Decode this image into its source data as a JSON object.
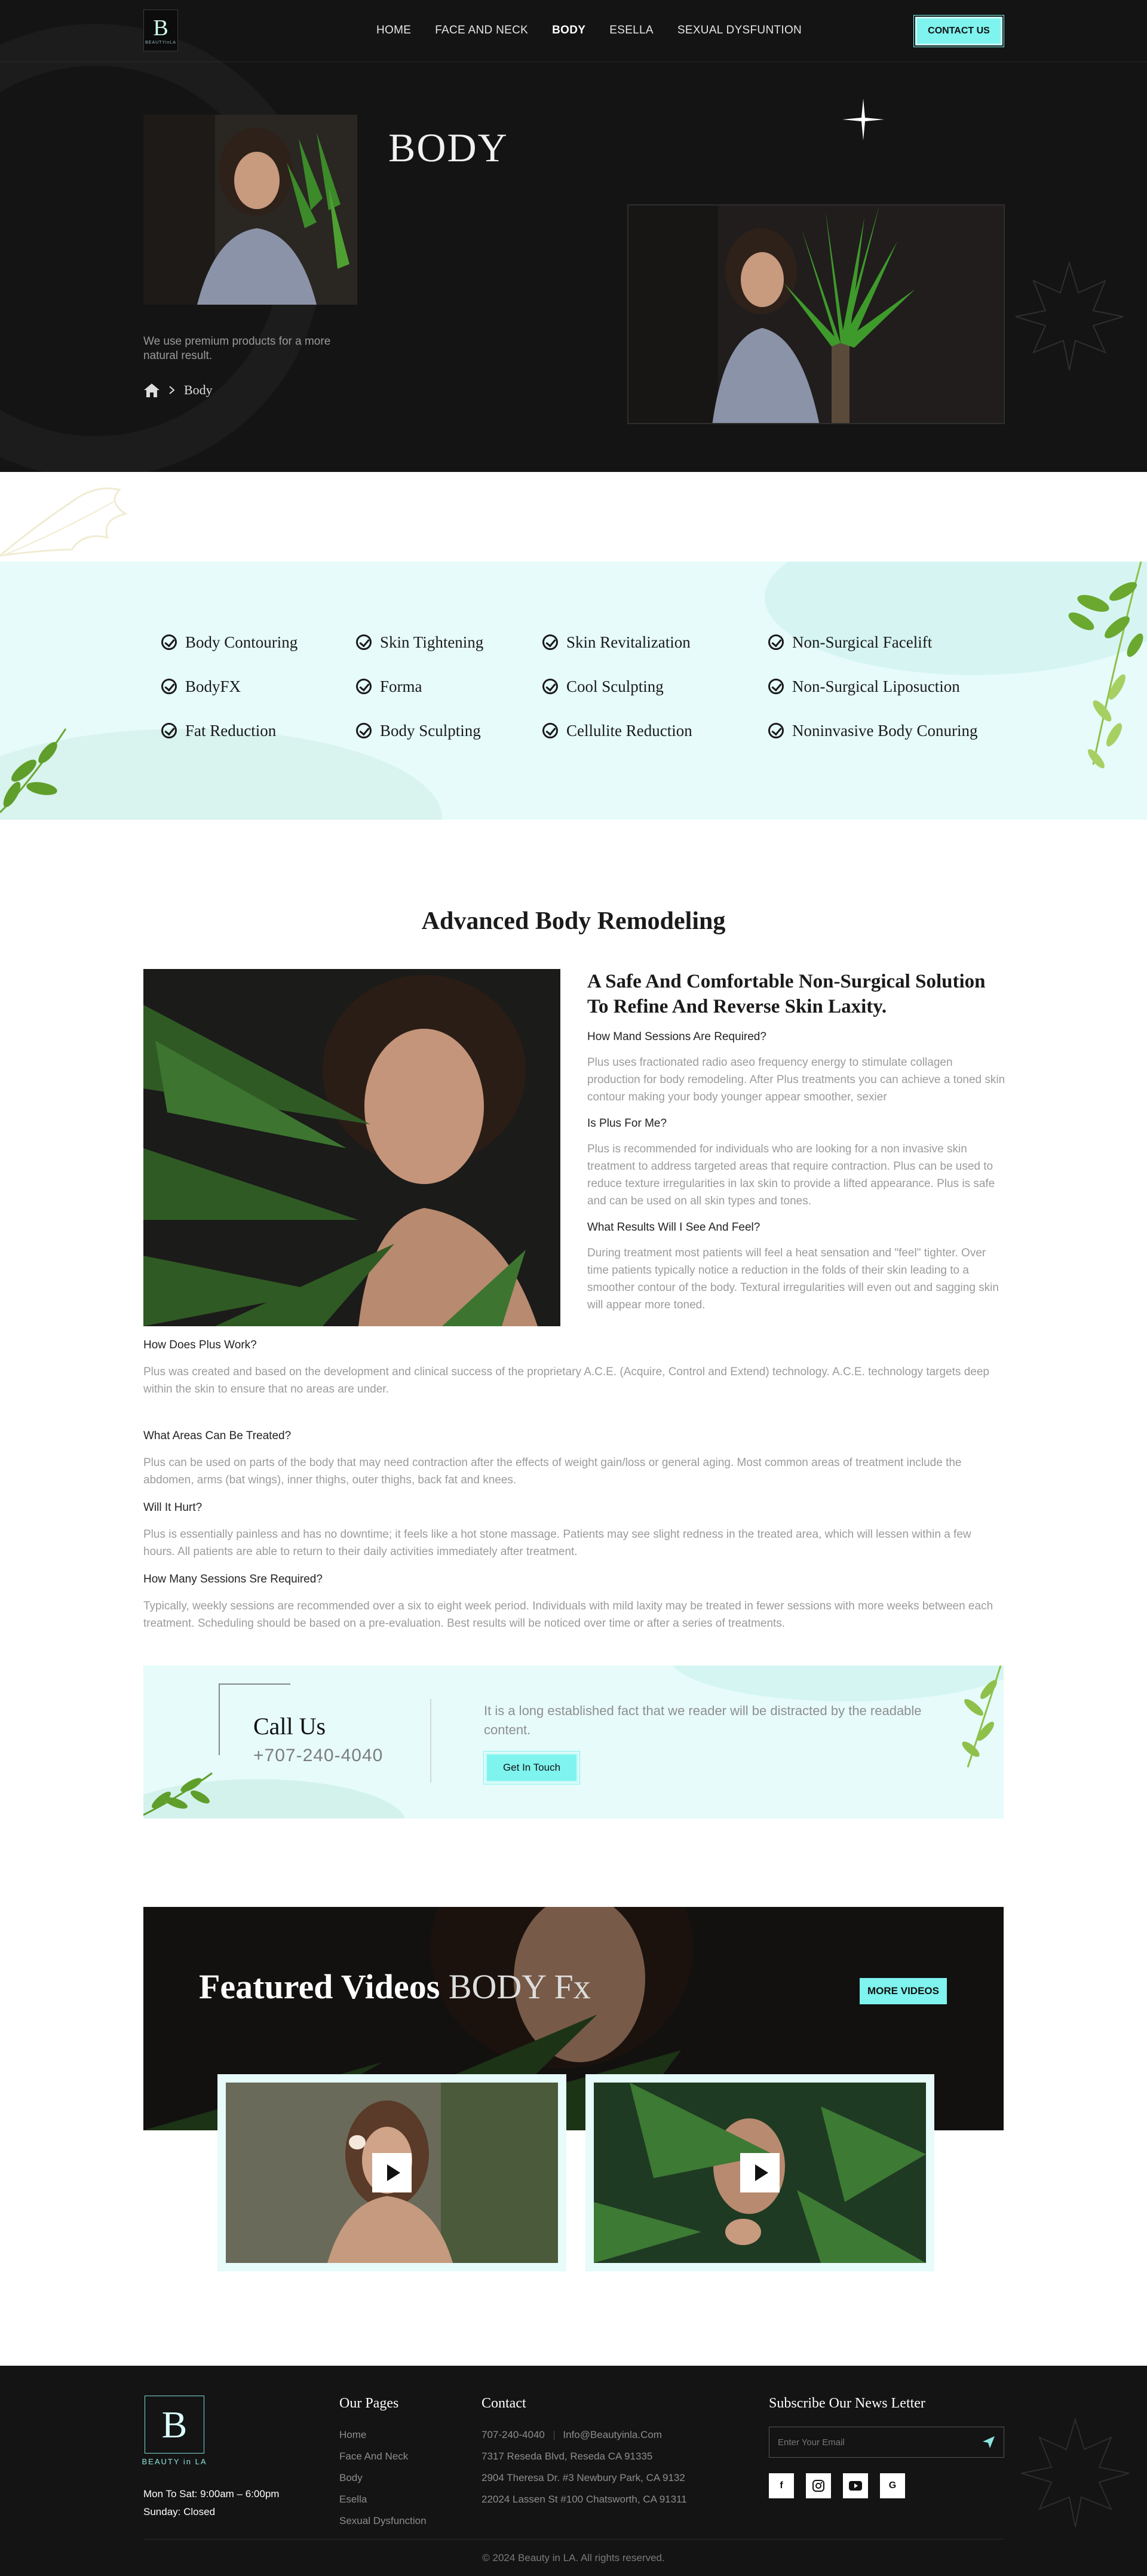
{
  "header": {
    "logo_text": "BEAUTYinLA",
    "nav": [
      "HOME",
      "FACE AND NECK",
      "BODY",
      "ESELLA",
      "SEXUAL DYSFUNTION"
    ],
    "contact_btn": "CONTACT US"
  },
  "hero": {
    "title": "BODY",
    "tagline": "We use premium products for a more natural result.",
    "breadcrumb": "Body"
  },
  "treatments": [
    "Body Contouring",
    "Skin Tightening",
    "Skin Revitalization",
    "Non-Surgical Facelift",
    "BodyFX",
    "Forma",
    "Cool Sculpting",
    "Non-Surgical Liposuction",
    "Fat Reduction",
    "Body Sculpting",
    "Cellulite Reduction",
    "Noninvasive Body Conuring"
  ],
  "section": {
    "title_bold": "Advanced Body",
    "title_rest": "Remodeling",
    "heading": "A Safe And Comfortable Non-Surgical Solution To Refine And Reverse Skin Laxity.",
    "faq": [
      {
        "q": "How Mand Sessions Are Required?",
        "a": "Plus uses fractionated radio aseo frequency energy to stimulate collagen production for body remodeling. After Plus treatments you can achieve a toned skin contour making your body younger appear smoother, sexier"
      },
      {
        "q": "Is Plus For Me?",
        "a": "Plus is recommended for individuals who are looking for a non  invasive skin treatment to address targeted areas that require contraction. Plus can be used to reduce texture irregularities in lax skin to provide a lifted appearance. Plus is safe and can be used on all skin types and tones."
      },
      {
        "q": "What Results Will I See And Feel?",
        "a": "During treatment most patients will feel a heat sensation and \"feel\" tighter. Over time patients typically notice a reduction in the folds of their skin leading to a smoother contour of the body. Textural irregularities will even out and sagging skin will appear more toned."
      },
      {
        "q": "How Does Plus Work?",
        "a": "Plus was created and based on the development and clinical success of the proprietary A.C.E. (Acquire, Control and Extend) technology. A.C.E. technology targets deep within the skin to ensure that no areas are under."
      },
      {
        "q": "What Areas Can Be Treated?",
        "a": "Plus can be used on parts of the body that may need contraction after the effects of weight gain/loss or general aging. Most common areas of treatment include the abdomen, arms (bat wings), inner thighs, outer thighs, back fat and knees."
      },
      {
        "q": "Will It Hurt?",
        "a": "Plus is essentially painless and has no downtime; it feels like a hot stone massage. Patients may see slight redness in the treated area, which will lessen within a few hours. All patients are able to return to their daily activities immediately after treatment."
      },
      {
        "q": "How Many Sessions Sre Required?",
        "a": "Typically, weekly sessions are recommended over a six to eight week period. Individuals with mild laxity may be treated in fewer sessions with more weeks between each treatment. Scheduling should be based on a pre-evaluation. Best results will be noticed over time or after a series of treatments."
      }
    ]
  },
  "call": {
    "title": "Call Us",
    "phone": "+707-240-4040",
    "text": "It is a long established fact that we reader will be distracted by the readable content.",
    "button": "Get In Touch"
  },
  "videos": {
    "title_bold": "Featured Videos",
    "title_rest": "BODY Fx",
    "more_btn": "MORE VIDEOS"
  },
  "footer": {
    "logo_text": "BEAUTY in LA",
    "hours1": "Mon To Sat: 9:00am – 6:00pm",
    "hours2": "Sunday: Closed",
    "pages_title": "Our Pages",
    "pages": [
      "Home",
      "Face And  Neck",
      "Body",
      "Esella",
      "Sexual Dysfunction"
    ],
    "contact_title": "Contact",
    "phone": "707-240-4040",
    "email": "Info@Beautyinla.Com",
    "addresses": [
      "7317 Reseda Blvd, Reseda CA 91335",
      "2904 Theresa Dr. #3 Newbury Park, CA 9132",
      "22024 Lassen St #100 Chatsworth, CA 91311"
    ],
    "subscribe_title": "Subscribe Our News Letter",
    "email_placeholder": "Enter Your Email",
    "socials": [
      "f",
      "ig",
      "yt",
      "G"
    ],
    "copyright": "© 2024 Beauty in LA. All rights reserved."
  },
  "colors": {
    "accent": "#7ff3ee",
    "mint": "#e6fbfa",
    "dark": "#141414"
  }
}
